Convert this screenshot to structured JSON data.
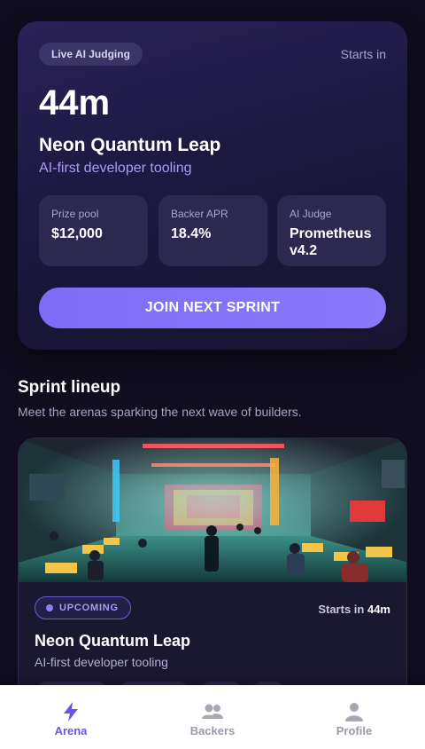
{
  "hero": {
    "badge": "Live AI Judging",
    "starts_label": "Starts in",
    "countdown": "44m",
    "title": "Neon Quantum Leap",
    "subtitle": "AI-first developer tooling",
    "stats": [
      {
        "label": "Prize pool",
        "value": "$12,000"
      },
      {
        "label": "Backer APR",
        "value": "18.4%"
      },
      {
        "label": "AI Judge",
        "value": "Prometheus v4.2"
      }
    ],
    "cta": "JOIN NEXT SPRINT"
  },
  "lineup": {
    "title": "Sprint lineup",
    "subtitle": "Meet the arenas sparking the next wave of builders.",
    "cards": [
      {
        "status": "UPCOMING",
        "starts_prefix": "Starts in",
        "starts_value": "44m",
        "title": "Neon Quantum Leap",
        "subtitle": "AI-first developer tooling",
        "image_icon": "neon-hackathon-arena-image"
      }
    ]
  },
  "tabbar": {
    "items": [
      {
        "label": "Arena",
        "icon": "lightning-icon",
        "active": true
      },
      {
        "label": "Backers",
        "icon": "users-icon",
        "active": false
      },
      {
        "label": "Profile",
        "icon": "user-icon",
        "active": false
      }
    ]
  },
  "colors": {
    "accent": "#7e6cf6",
    "background": "#0f0d1e",
    "card": "#1c1840",
    "active_tab": "#6b55e8",
    "inactive_tab": "#9a9aa6"
  }
}
